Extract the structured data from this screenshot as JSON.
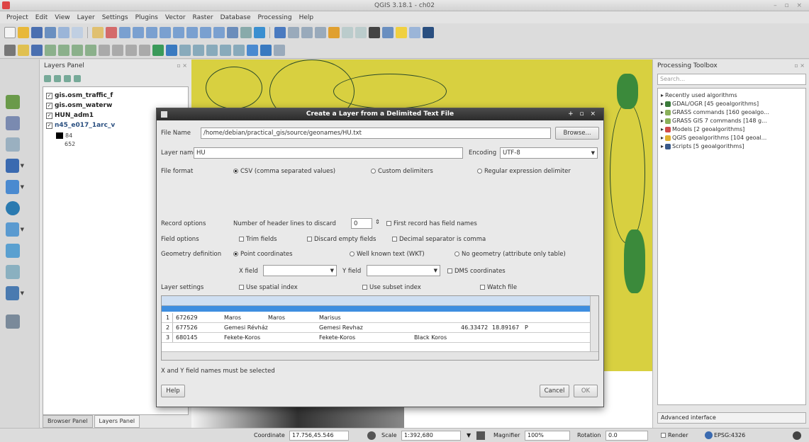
{
  "window": {
    "title": "QGIS 3.18.1 - ch02"
  },
  "menubar": [
    "Project",
    "Edit",
    "View",
    "Layer",
    "Settings",
    "Plugins",
    "Vector",
    "Raster",
    "Database",
    "Processing",
    "Help"
  ],
  "layers_panel": {
    "title": "Layers Panel",
    "layers": [
      {
        "name": "gis.osm_traffic_f"
      },
      {
        "name": "gis.osm_waterw"
      },
      {
        "name": "HUN_adm1"
      },
      {
        "name": "n45_e017_1arc_v"
      }
    ],
    "legend": [
      "84",
      "652"
    ],
    "tabs": [
      "Browser Panel",
      "Layers Panel"
    ]
  },
  "toolbox": {
    "title": "Processing Toolbox",
    "search_placeholder": "Search...",
    "items": [
      "Recently used algorithms",
      "GDAL/OGR [45 geoalgorithms]",
      "GRASS commands [160 geoalgo...",
      "GRASS GIS 7 commands [148 g...",
      "Models [2 geoalgorithms]",
      "QGIS geoalgorithms [104 geoal...",
      "Scripts [5 geoalgorithms]"
    ],
    "advanced": "Advanced interface"
  },
  "dialog": {
    "title": "Create a Layer from a Delimited Text File",
    "file_name_label": "File Name",
    "file_name_value": "/home/debian/practical_gis/source/geonames/HU.txt",
    "browse": "Browse...",
    "layer_name_label": "Layer name",
    "layer_name_value": "HU",
    "encoding_label": "Encoding",
    "encoding_value": "UTF-8",
    "file_format_label": "File format",
    "fmt_csv": "CSV (comma separated values)",
    "fmt_custom": "Custom delimiters",
    "fmt_regex": "Regular expression delimiter",
    "record_options_label": "Record options",
    "header_lines_label": "Number of header lines to discard",
    "header_lines_value": "0",
    "first_record_names": "First record has field names",
    "field_options_label": "Field options",
    "trim_fields": "Trim fields",
    "discard_empty": "Discard empty fields",
    "decimal_comma": "Decimal separator is comma",
    "geometry_label": "Geometry definition",
    "geom_point": "Point coordinates",
    "geom_wkt": "Well known text (WKT)",
    "geom_none": "No geometry (attribute only table)",
    "x_field": "X field",
    "y_field": "Y field",
    "dms": "DMS coordinates",
    "layer_settings_label": "Layer settings",
    "spatial_index": "Use spatial index",
    "subset_index": "Use subset index",
    "watch_file": "Watch file",
    "sample_rows": [
      [
        "1",
        "672629",
        "Maros",
        "Maros",
        "Marisus",
        "",
        "",
        ""
      ],
      [
        "2",
        "677526",
        "Gemesi Révház",
        "Gemesi Revhaz",
        "",
        "46.33472",
        "18.89167",
        "P"
      ],
      [
        "3",
        "680145",
        "Fekete-Koros",
        "Fekete-Koros",
        "Black Koros",
        "",
        "",
        ""
      ]
    ],
    "message": "X and Y field names must be selected",
    "help": "Help",
    "cancel": "Cancel",
    "ok": "OK"
  },
  "statusbar": {
    "coordinate_label": "Coordinate",
    "coordinate_value": "17.756,45.546",
    "scale_label": "Scale",
    "scale_value": "1:392,680",
    "magnifier_label": "Magnifier",
    "magnifier_value": "100%",
    "rotation_label": "Rotation",
    "rotation_value": "0.0",
    "render": "Render",
    "epsg": "EPSG:4326"
  },
  "colors": {
    "map_fill": "#d8d040",
    "dialog_title": "#2b2b2b",
    "selection": "#3e8ee0"
  }
}
